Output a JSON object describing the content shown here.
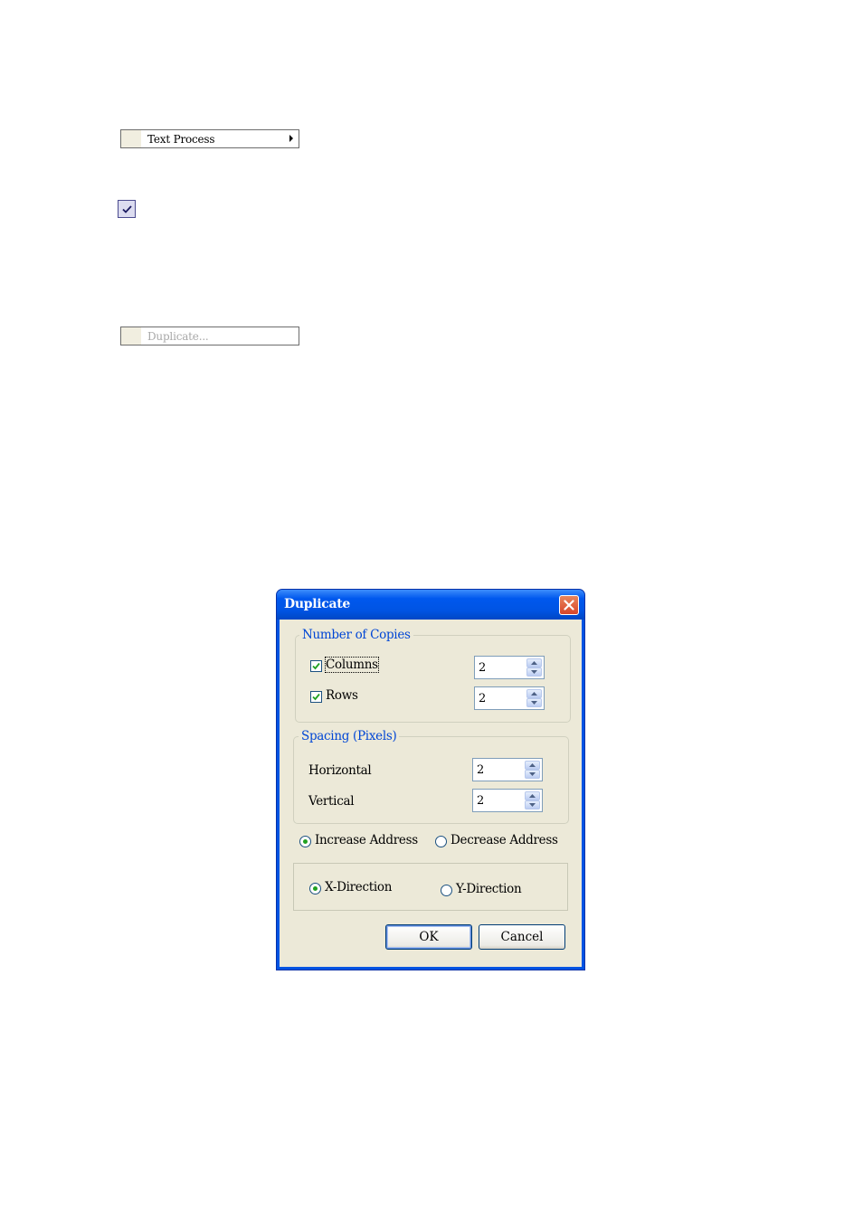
{
  "menu_items": {
    "text_process": {
      "label": "Text Process"
    },
    "duplicate": {
      "label": "Duplicate..."
    }
  },
  "icons": {
    "submenu_arrow": "triangle-right",
    "check": "check-icon",
    "close": "close-icon"
  },
  "dialog": {
    "title": "Duplicate",
    "number_of_copies": {
      "legend": "Number of Copies",
      "columns": {
        "label": "Columns",
        "checked": true,
        "value": "2"
      },
      "rows": {
        "label": "Rows",
        "checked": true,
        "value": "2"
      }
    },
    "spacing": {
      "legend": "Spacing (Pixels)",
      "horizontal": {
        "label": "Horizontal",
        "value": "2"
      },
      "vertical": {
        "label": "Vertical",
        "value": "2"
      }
    },
    "address": {
      "increase_label": "Increase Address",
      "decrease_label": "Decrease Address",
      "selected": "increase"
    },
    "direction": {
      "x_label": "X-Direction",
      "y_label": "Y-Direction",
      "selected": "x"
    },
    "buttons": {
      "ok": "OK",
      "cancel": "Cancel"
    }
  },
  "colors": {
    "title_bar": "#0054e3",
    "dialog_face": "#ece9d8",
    "group_legend": "#0046d5",
    "close_button": "#d8452a",
    "check_mark": "#21a121"
  }
}
